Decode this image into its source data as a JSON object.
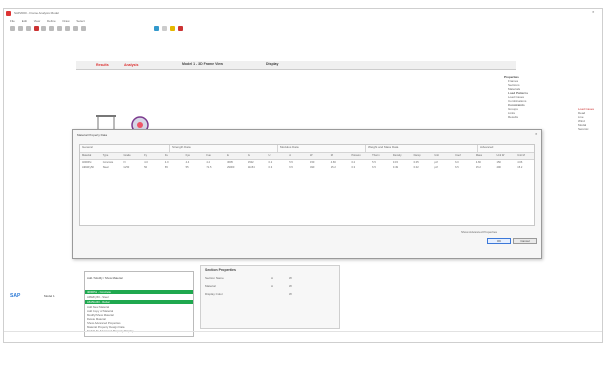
{
  "window": {
    "title": "SAP2000 - Frame Analysis Model"
  },
  "menu": [
    "File",
    "Edit",
    "View",
    "Define",
    "Draw",
    "Select"
  ],
  "toolbar": {
    "count": 10
  },
  "top_tabs": {
    "left_red": "Results",
    "mid_red": "Analysis",
    "title": "Model 1 - 3D Frame View",
    "extra": "Display"
  },
  "right_panel": {
    "items": [
      "Properties",
      "Frames",
      "Sections",
      "Materials",
      "Load Patterns",
      "Load Cases",
      "Combinations",
      "Constraints",
      "Groups",
      "Links",
      "Results"
    ]
  },
  "far_right": {
    "items": [
      "Load Cases",
      "Dead",
      "Live",
      "Wind",
      "Modal",
      "Seismic"
    ]
  },
  "dialog": {
    "title": "Material Property Data",
    "groups": [
      "General",
      "Strength Data",
      "Modulus Data",
      "Weight and Mass Data",
      "Advanced"
    ],
    "columns": [
      "Material",
      "Type",
      "Grade",
      "Fy",
      "Fu",
      "Fye",
      "Fue",
      "E",
      "G",
      "U",
      "A",
      "W",
      "M",
      "Poisson",
      "Therm",
      "Density",
      "Damp",
      "Unit",
      "Coef",
      "Mass",
      "Unit W",
      "Unit M"
    ],
    "rows": [
      [
        "4000Psi",
        "Concrete",
        "f'c",
        "4.0",
        "4.0",
        "4.4",
        "4.4",
        "3605",
        "1502",
        "0.2",
        "5.5",
        "150",
        "4.66",
        "0.2",
        "5.5",
        "0.15",
        "0.05",
        "pcf",
        "6.0",
        "4.66",
        "150",
        "4.66"
      ],
      [
        "A992Fy50",
        "Steel",
        "Gr50",
        "50",
        "65",
        "55",
        "71.5",
        "29000",
        "11154",
        "0.3",
        "6.5",
        "490",
        "15.2",
        "0.3",
        "6.5",
        "0.49",
        "0.02",
        "pcf",
        "6.5",
        "15.2",
        "490",
        "15.2"
      ]
    ],
    "footer_text": "Show Advanced Properties",
    "ok_label": "OK",
    "cancel_label": "Cancel"
  },
  "left_logo": {
    "text": "SAP",
    "sub": "Model 1"
  },
  "bottom_list": {
    "header": "Add / Modify / Show Material",
    "items": [
      "4000Psi - Concrete",
      "A992Fy50 - Steel",
      "A615Gr60 - Rebar",
      "Add New Material",
      "Add Copy of Material",
      "Modify/Show Material",
      "Delete Material",
      "Show Advanced Properties",
      "Material Property Design Data",
      "Switch To Advanced Property Display"
    ]
  },
  "bottom_panel": {
    "title": "Section Properties",
    "rows": [
      {
        "label": "Section Name",
        "v1": "A",
        "v2": "W"
      },
      {
        "label": "Material",
        "v1": "A",
        "v2": "W"
      },
      {
        "label": "Display Color",
        "v1": "",
        "v2": "W"
      }
    ]
  },
  "colors": {
    "accent_green": "#1fa84f",
    "red_tab": "#dd3333",
    "select_blue": "#3c78d8"
  }
}
